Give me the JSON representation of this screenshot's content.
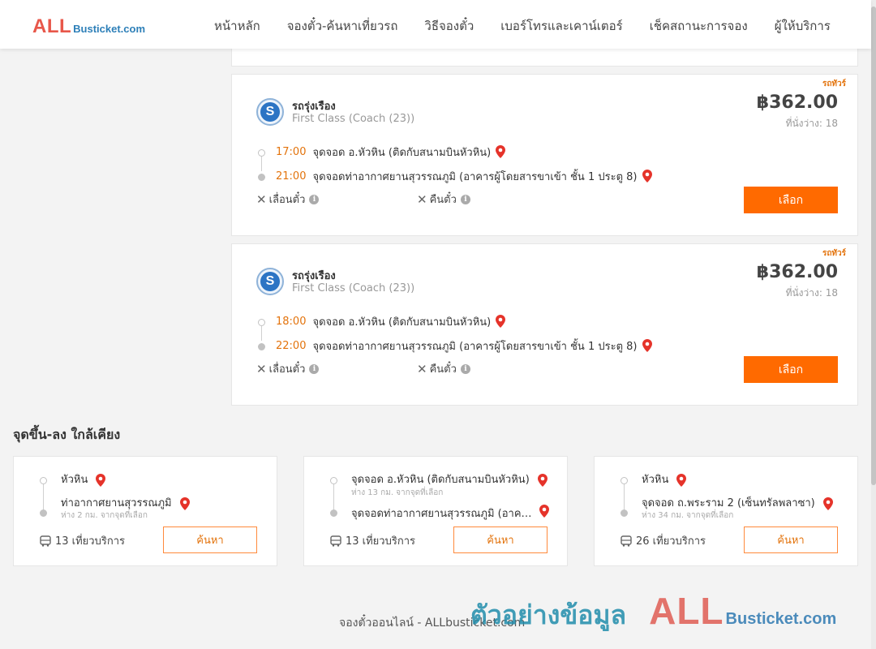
{
  "header": {
    "logo_big": "ALL",
    "logo_small": "Busticket.com",
    "nav": [
      "หน้าหลัก",
      "จองตั๋ว-ค้นหาเที่ยวรถ",
      "วิธีจองตั๋ว",
      "เบอร์โทรและเคาน์เตอร์",
      "เช็คสถานะการจอง",
      "ผู้ให้บริการ"
    ]
  },
  "trips": [
    {
      "tag": "รถทัวร์",
      "operator": "รถรุ่งเรือง",
      "class": "First Class (Coach (23))",
      "price": "฿362.00",
      "seats": "ที่นั่งว่าง: 18",
      "depart_time": "17:00",
      "depart_place": "จุดจอด อ.หัวหิน (ติดกับสนามบินหัวหิน)",
      "arrive_time": "21:00",
      "arrive_place": "จุดจอดท่าอากาศยานสุวรรณภูมิ (อาคารผู้โดยสารขาเข้า ชั้น 1 ประตู 8)",
      "opt_move": "เลื่อนตั๋ว",
      "opt_refund": "คืนตั๋ว",
      "select_label": "เลือก"
    },
    {
      "tag": "รถทัวร์",
      "operator": "รถรุ่งเรือง",
      "class": "First Class (Coach (23))",
      "price": "฿362.00",
      "seats": "ที่นั่งว่าง: 18",
      "depart_time": "18:00",
      "depart_place": "จุดจอด อ.หัวหิน (ติดกับสนามบินหัวหิน)",
      "arrive_time": "22:00",
      "arrive_place": "จุดจอดท่าอากาศยานสุวรรณภูมิ (อาคารผู้โดยสารขาเข้า ชั้น 1 ประตู 8)",
      "opt_move": "เลื่อนตั๋ว",
      "opt_refund": "คืนตั๋ว",
      "select_label": "เลือก"
    }
  ],
  "nearby": {
    "title": "จุดขึ้น-ลง ใกล้เคียง",
    "items": [
      {
        "from": "หัวหิน",
        "from_distance": "",
        "to": "ท่าอากาศยานสุวรรณภูมิ",
        "to_distance": "ห่าง 2 กม. จากจุดที่เลือก",
        "trips": "13 เที่ยวบริการ",
        "search_label": "ค้นหา"
      },
      {
        "from": "จุดจอด อ.หัวหิน (ติดกับสนามบินหัวหิน)",
        "from_distance": "ห่าง 13 กม. จากจุดที่เลือก",
        "to": "จุดจอดท่าอากาศยานสุวรรณภูมิ (อาคารผู้โดยสารขาเข้า)",
        "to_distance": "",
        "trips": "13 เที่ยวบริการ",
        "search_label": "ค้นหา"
      },
      {
        "from": "หัวหิน",
        "from_distance": "",
        "to": "จุดจอด ถ.พระราม 2 (เซ็นทรัลพลาซา)",
        "to_distance": "ห่าง 34 กม. จากจุดที่เลือก",
        "trips": "26 เที่ยวบริการ",
        "search_label": "ค้นหา"
      }
    ]
  },
  "footer": {
    "text": "จองตั๋วออนไลน์ - ALLbusticket.com"
  },
  "watermark": {
    "thai": "ตัวอย่างข้อมูล",
    "all": "ALL",
    "busticket": "Busticket.com"
  },
  "colors": {
    "accent_orange": "#ff6a00",
    "time_orange": "#e3730c",
    "pin_red": "#e5332a"
  },
  "icons": {
    "pin": "map-pin-icon",
    "cross": "cross-icon",
    "info": "info-icon",
    "bus": "bus-icon"
  }
}
